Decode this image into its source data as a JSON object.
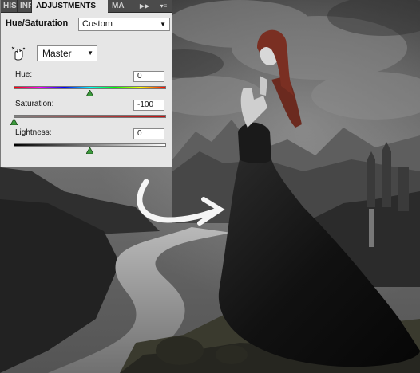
{
  "tabs": [
    "HIS",
    "INF",
    "ADJUSTMENTS",
    "MA"
  ],
  "panel": {
    "title": "Hue/Saturation",
    "preset": "Custom",
    "channel": "Master",
    "hue_label": "Hue:",
    "hue_value": "0",
    "saturation_label": "Saturation:",
    "saturation_value": "-100",
    "lightness_label": "Lightness:",
    "lightness_value": "0"
  },
  "slider_levels": {
    "hue": 0.5,
    "saturation": 0.0,
    "lightness": 0.5
  },
  "colors": {
    "panel_bg": "#e6e6e6",
    "tab_bar": "#4b4b4b",
    "thumb": "#3c9a3c",
    "arrow": "#ffffff"
  },
  "icons": [
    "target-adjust-icon",
    "fast-forward-icon",
    "panel-menu-icon",
    "dropdown-arrow-icon",
    "curved-arrow-icon"
  ]
}
